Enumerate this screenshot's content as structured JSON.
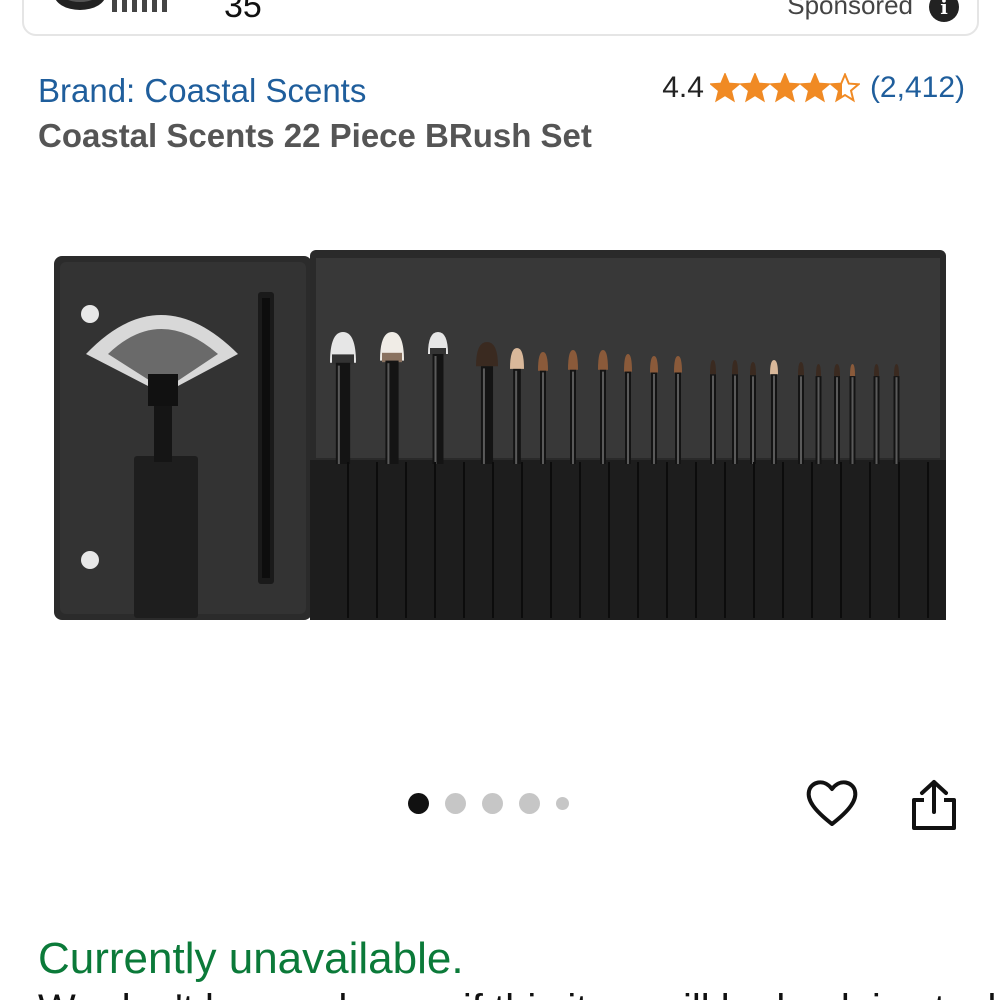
{
  "ad": {
    "price": "35",
    "sponsored_label": "Sponsored",
    "info_icon": "info-icon"
  },
  "product": {
    "brand": "Brand: Coastal Scents",
    "title": "Coastal Scents 22 Piece BRush Set",
    "rating_value": "4.4",
    "rating_stars": 4.4,
    "rating_count": "(2,412)",
    "star_color": "#f08a24",
    "link_color": "#1f5e9c",
    "image_description_icon": "brush-set-photo"
  },
  "carousel": {
    "total_dots": 5,
    "active_index": 0
  },
  "actions": {
    "wishlist_icon": "heart-icon",
    "share_icon": "share-icon"
  },
  "availability": {
    "status": "Currently unavailable.",
    "status_color": "#0b7a39",
    "note": "We don't know when or if this item will be back in stock."
  }
}
